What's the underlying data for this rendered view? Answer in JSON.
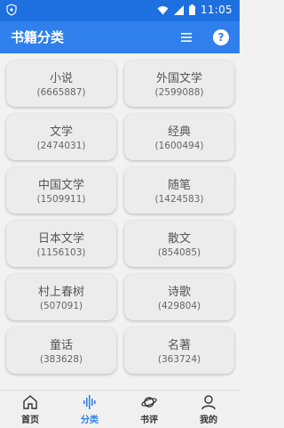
{
  "status_bar": {
    "time": "11:05"
  },
  "app_bar": {
    "title": "书籍分类"
  },
  "categories": [
    {
      "name": "小说",
      "count": "(6665887)"
    },
    {
      "name": "外国文学",
      "count": "(2599088)"
    },
    {
      "name": "文学",
      "count": "(2474031)"
    },
    {
      "name": "经典",
      "count": "(1600494)"
    },
    {
      "name": "中国文学",
      "count": "(1509911)"
    },
    {
      "name": "随笔",
      "count": "(1424583)"
    },
    {
      "name": "日本文学",
      "count": "(1156103)"
    },
    {
      "name": "散文",
      "count": "(854085)"
    },
    {
      "name": "村上春树",
      "count": "(507091)"
    },
    {
      "name": "诗歌",
      "count": "(429804)"
    },
    {
      "name": "童话",
      "count": "(383628)"
    },
    {
      "name": "名著",
      "count": "(363724)"
    }
  ],
  "bottom_nav": [
    {
      "label": "首页",
      "icon": "home-icon"
    },
    {
      "label": "分类",
      "icon": "waveform-icon"
    },
    {
      "label": "书评",
      "icon": "planet-icon"
    },
    {
      "label": "我的",
      "icon": "profile-icon"
    }
  ],
  "colors": {
    "accent": "#2f80ed",
    "status_bar": "#1e6fe0"
  }
}
